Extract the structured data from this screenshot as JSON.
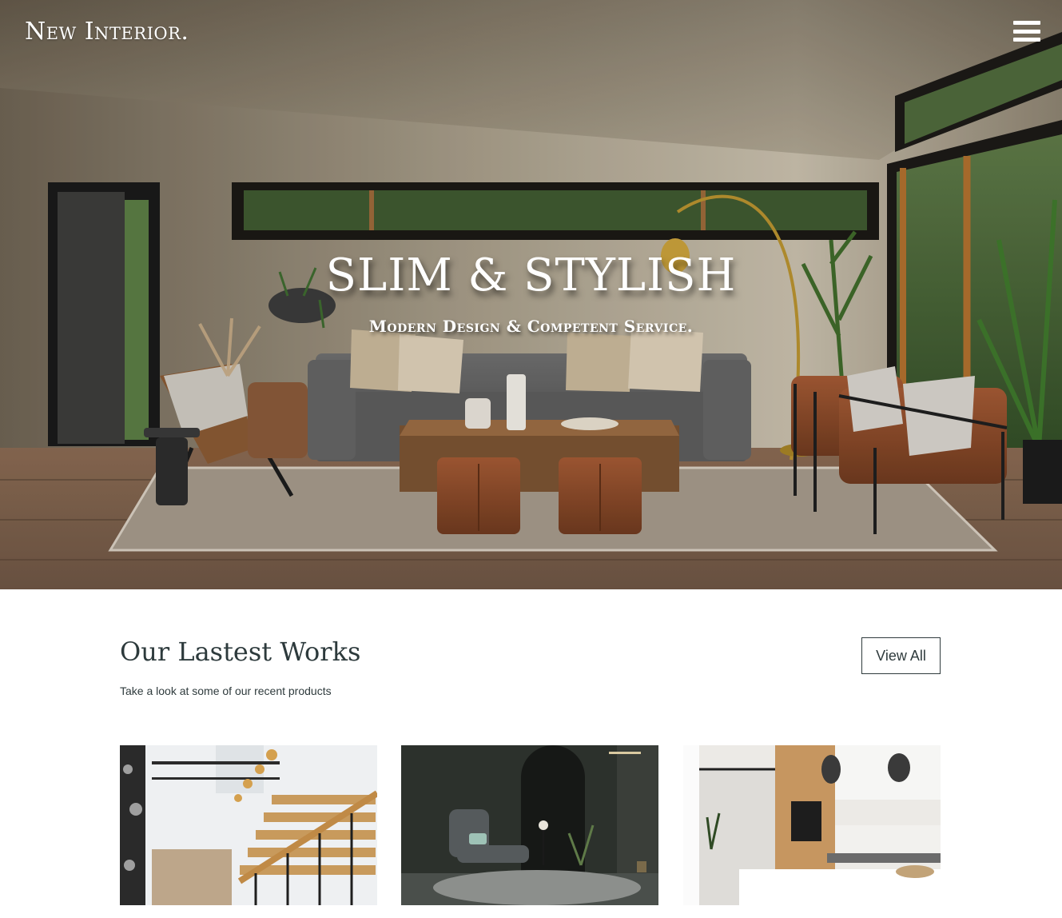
{
  "brand": {
    "logo_text": "New Interior."
  },
  "nav": {
    "menu_icon": "hamburger-menu-icon"
  },
  "hero": {
    "title": "SLIM & STYLISH",
    "subtitle": "Modern Design & Competent Service."
  },
  "works": {
    "title": "Our Lastest Works",
    "description": "Take a look at some of our recent products",
    "view_all_label": "View All",
    "cards": [
      {
        "image": "staircase-interior-photo"
      },
      {
        "image": "dark-lounge-chair-photo"
      },
      {
        "image": "modern-kitchen-photo"
      }
    ]
  },
  "colors": {
    "text": "#2f3b3d",
    "hero_wall": "#a39a86",
    "background": "#ffffff"
  }
}
